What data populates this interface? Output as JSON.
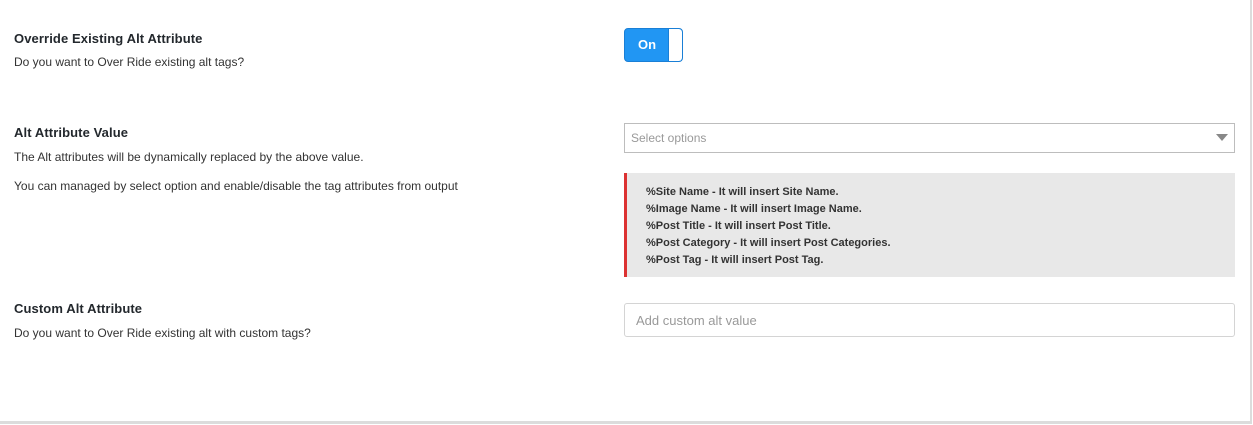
{
  "override": {
    "title": "Override Existing Alt Attribute",
    "description": "Do you want to Over Ride existing alt tags?",
    "toggle_label": "On",
    "toggle_state": "on"
  },
  "alt_value": {
    "title": "Alt Attribute Value",
    "description_1": "The Alt attributes will be dynamically replaced by the above value.",
    "description_2": "You can managed by select option and enable/disable the tag attributes from output",
    "select_placeholder": "Select options",
    "info_lines": [
      "%Site Name - It will insert Site Name.",
      "%Image Name - It will insert Image Name.",
      "%Post Title - It will insert Post Title.",
      "%Post Category - It will insert Post Categories.",
      "%Post Tag - It will insert Post Tag."
    ]
  },
  "custom_alt": {
    "title": "Custom Alt Attribute",
    "description": "Do you want to Over Ride existing alt with custom tags?",
    "input_placeholder": "Add custom alt value",
    "input_value": ""
  },
  "colors": {
    "toggle_on": "#2196f3",
    "info_border": "#dc3232",
    "info_background": "#e8e8e8"
  }
}
